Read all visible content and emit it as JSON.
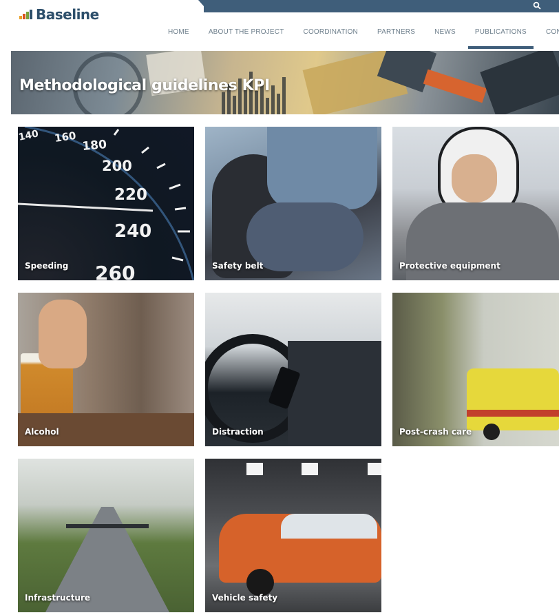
{
  "header": {
    "logo_text": "Baseline",
    "search_icon": "search-icon"
  },
  "nav": {
    "items": [
      {
        "label": "HOME"
      },
      {
        "label": "ABOUT THE PROJECT"
      },
      {
        "label": "COORDINATION"
      },
      {
        "label": "PARTNERS"
      },
      {
        "label": "NEWS"
      },
      {
        "label": "PUBLICATIONS"
      },
      {
        "label": "CONTA"
      }
    ],
    "active": "PUBLICATIONS"
  },
  "hero": {
    "title": "Methodological guidelines KPI"
  },
  "tiles": [
    {
      "label": "Speeding"
    },
    {
      "label": "Safety belt"
    },
    {
      "label": "Protective equipment"
    },
    {
      "label": "Alcohol"
    },
    {
      "label": "Distraction"
    },
    {
      "label": "Post-crash care"
    },
    {
      "label": "Infrastructure"
    },
    {
      "label": "Vehicle safety"
    }
  ],
  "speedometer": {
    "numbers": [
      "140",
      "160",
      "180",
      "200",
      "220",
      "240",
      "260"
    ]
  },
  "colors": {
    "brand": "#3f5e7a",
    "nav_text": "#6e7f8c",
    "logo": "#2d4f6b"
  }
}
